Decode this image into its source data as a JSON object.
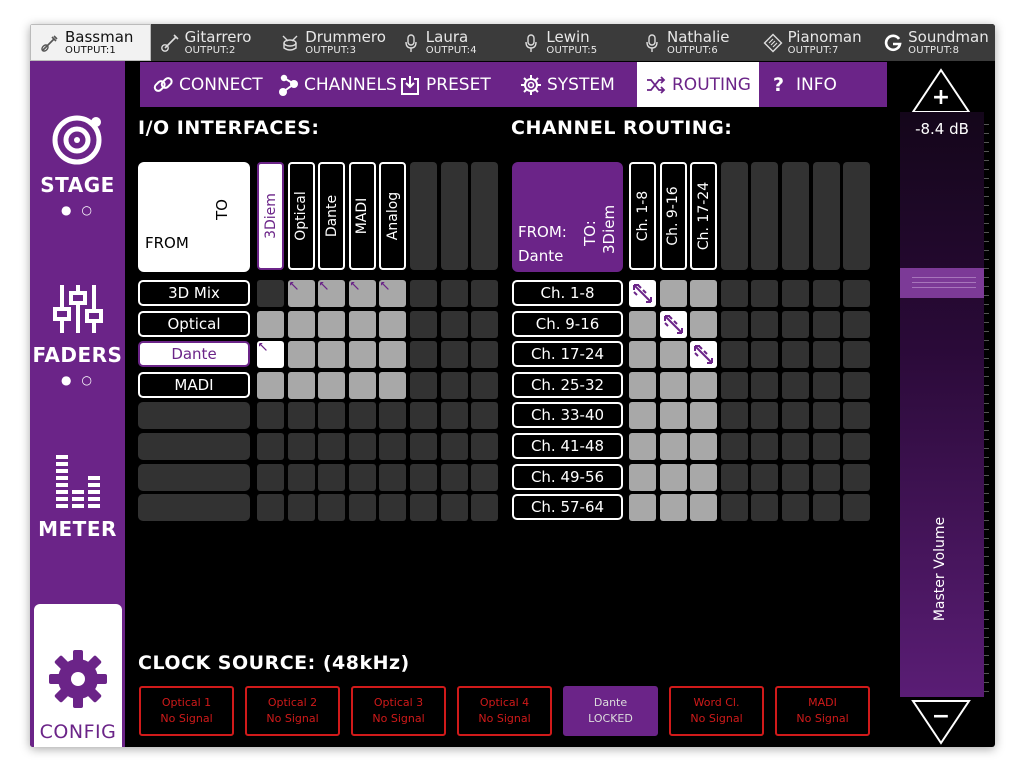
{
  "outputs": [
    {
      "name": "Bassman",
      "sub": "OUTPUT:1",
      "icon": "bass-guitar-icon",
      "active": true
    },
    {
      "name": "Gitarrero",
      "sub": "OUTPUT:2",
      "icon": "guitar-icon"
    },
    {
      "name": "Drummero",
      "sub": "OUTPUT:3",
      "icon": "drum-icon"
    },
    {
      "name": "Laura",
      "sub": "OUTPUT:4",
      "icon": "microphone-icon"
    },
    {
      "name": "Lewin",
      "sub": "OUTPUT:5",
      "icon": "microphone-icon"
    },
    {
      "name": "Nathalie",
      "sub": "OUTPUT:6",
      "icon": "microphone-icon"
    },
    {
      "name": "Pianoman",
      "sub": "OUTPUT:7",
      "icon": "keyboard-icon"
    },
    {
      "name": "Soundman",
      "sub": "OUTPUT:8",
      "icon": "g-logo-icon"
    }
  ],
  "sidebar": {
    "stage": "STAGE",
    "faders": "FADERS",
    "meter": "METER",
    "config": "CONFIG"
  },
  "nav": {
    "connect": "CONNECT",
    "channels": "CHANNELS",
    "preset": "PRESET",
    "system": "SYSTEM",
    "routing": "ROUTING",
    "info_icon": "?",
    "info": "INFO"
  },
  "io": {
    "title": "I/O INTERFACES:",
    "corner_from": "FROM",
    "corner_to": "TO",
    "columns": [
      "3Diem",
      "Optical",
      "Dante",
      "MADI",
      "Analog"
    ],
    "rows": [
      "3D Mix",
      "Optical",
      "Dante",
      "MADI"
    ]
  },
  "routing": {
    "title": "CHANNEL ROUTING:",
    "corner_from": "FROM:",
    "corner_source": "Dante",
    "corner_to": "TO:",
    "corner_dest": "3Diem",
    "columns": [
      "Ch. 1-8",
      "Ch. 9-16",
      "Ch. 17-24"
    ],
    "rows": [
      "Ch. 1-8",
      "Ch. 9-16",
      "Ch. 17-24",
      "Ch. 25-32",
      "Ch. 33-40",
      "Ch. 41-48",
      "Ch. 49-56",
      "Ch. 57-64"
    ]
  },
  "clock": {
    "title": "CLOCK SOURCE: (48kHz)",
    "sources": [
      {
        "name": "Optical 1",
        "status": "No Signal"
      },
      {
        "name": "Optical 2",
        "status": "No Signal"
      },
      {
        "name": "Optical 3",
        "status": "No Signal"
      },
      {
        "name": "Optical 4",
        "status": "No Signal"
      },
      {
        "name": "Dante",
        "status": "LOCKED",
        "active": true
      },
      {
        "name": "Word Cl.",
        "status": "No Signal"
      },
      {
        "name": "MADI",
        "status": "No Signal"
      }
    ]
  },
  "volume": {
    "db": "-8.4 dB",
    "label": "Master Volume",
    "plus": "+",
    "minus": "−"
  },
  "colors": {
    "accent": "#6b2488",
    "alert": "#d01a1a",
    "cell_active": "#a8a8a8",
    "cell_inactive": "#323232"
  }
}
